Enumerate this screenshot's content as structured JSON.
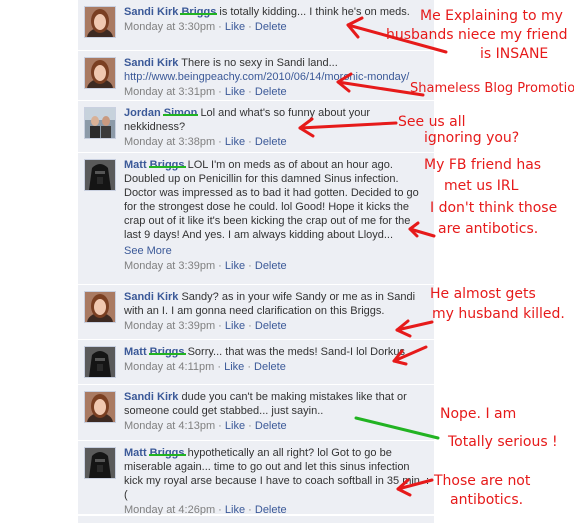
{
  "comments": [
    {
      "author_first": "Sandi Kirk",
      "author_last": "",
      "text": "is totally kidding... I think he's on meds.",
      "struck": "Briggs",
      "link": "",
      "see_more": "",
      "time": "Monday at 3:30pm",
      "like": "Like",
      "delete": "Delete"
    },
    {
      "author_first": "Sandi Kirk",
      "author_last": "",
      "text": "There is no sexy in Sandi land...",
      "struck": "",
      "link": "http://www.beingpeachy.com/2010/06/14/moronic-monday/",
      "see_more": "",
      "time": "Monday at 3:31pm",
      "like": "Like",
      "delete": "Delete"
    },
    {
      "author_first": "Jordan",
      "author_last": "",
      "text": "Lol and what's so funny about your nekkidness?",
      "struck": "Simon",
      "link": "",
      "see_more": "",
      "time": "Monday at 3:38pm",
      "like": "Like",
      "delete": "Delete"
    },
    {
      "author_first": "Matt",
      "author_last": "",
      "text": "LOL I'm on meds as of about an hour ago. Doubled up on Penicillin for this damned Sinus infection. Doctor was impressed as to bad it had gotten. Decided to go for the strongest dose he could. lol Good! Hope it kicks the crap out of it like it's been kicking the crap out of me for the last 9 days! And yes. I am always kidding about Lloyd...",
      "struck": "Briggs",
      "link": "",
      "see_more": "See More",
      "time": "Monday at 3:39pm",
      "like": "Like",
      "delete": "Delete"
    },
    {
      "author_first": "Sandi Kirk",
      "author_last": "",
      "text": "Sandy? as in your wife Sandy or me as in Sandi with an I. I am gonna need clarification on this Briggs.",
      "struck": "",
      "link": "",
      "see_more": "",
      "time": "Monday at 3:39pm",
      "like": "Like",
      "delete": "Delete"
    },
    {
      "author_first": "Matt",
      "author_last": "",
      "text": "Sorry... that was the meds! Sand-I lol Dorkus",
      "struck": "Briggs",
      "link": "",
      "see_more": "",
      "time": "Monday at 4:11pm",
      "like": "Like",
      "delete": "Delete"
    },
    {
      "author_first": "Sandi Kirk",
      "author_last": "",
      "text": "dude you can't be making mistakes like that or someone could get stabbed... just sayin..",
      "struck": "",
      "link": "",
      "see_more": "",
      "time": "Monday at 4:13pm",
      "like": "Like",
      "delete": "Delete"
    },
    {
      "author_first": "Matt",
      "author_last": "",
      "text": "hypothetically an all right? lol Got to go be miserable again... time to go out and let this sinus infection kick my royal arse because I have to coach softball in 35 min. :(",
      "struck": "Briggs",
      "link": "",
      "see_more": "",
      "time": "Monday at 4:26pm",
      "like": "Like",
      "delete": "Delete"
    }
  ],
  "annotations": {
    "a1_l1": "Me Explaining to my",
    "a1_l2": "husbands niece my friend",
    "a1_l3": "is INSANE",
    "a2_l1": "Shameless Blog Promotion",
    "a3_l1": "See us all",
    "a3_l2": "ignoring you?",
    "a4_l1": "My FB friend has",
    "a4_l2": "met us IRL",
    "a4_l3": "I don't think those",
    "a4_l4": "are antibotics.",
    "a5_l1": "He almost gets",
    "a5_l2": "my husband killed.",
    "a6_l1": "Nope. I am",
    "a6_l2": "Totally serious !",
    "a7_l1": "Those are not",
    "a7_l2": "antibotics."
  },
  "colors": {
    "annotation_red": "#e61a1a",
    "annotation_green": "#22b322",
    "facebook_blue": "#3b5998",
    "comment_background": "#edeff4"
  }
}
